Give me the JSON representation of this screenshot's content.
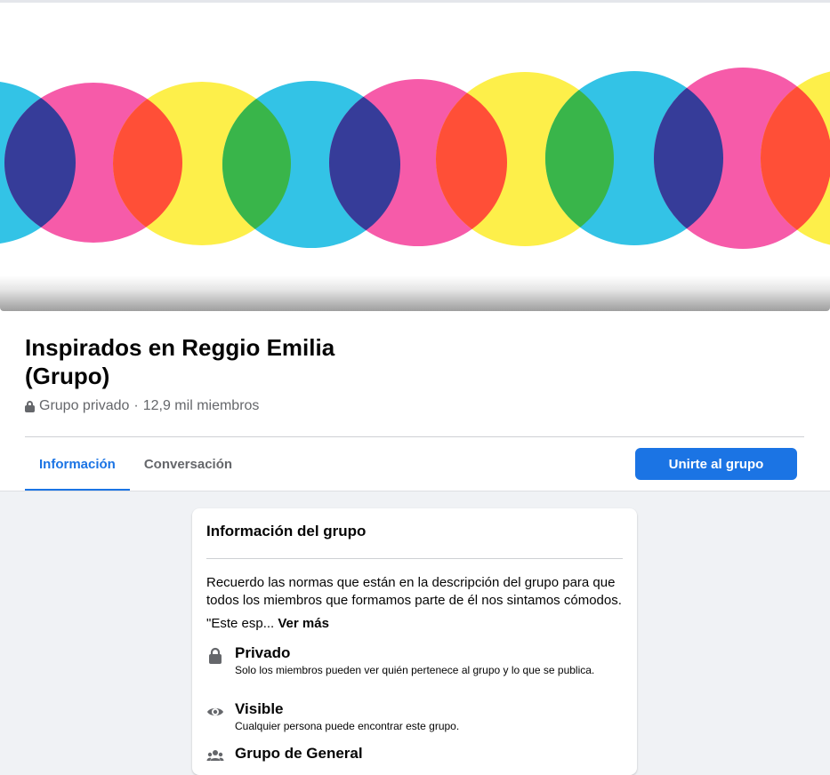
{
  "group": {
    "name": "Inspirados en Reggio Emilia (Grupo)",
    "privacy": "Grupo privado",
    "separator": "·",
    "members": "12,9 mil miembros"
  },
  "tabs": [
    {
      "label": "Información",
      "active": true
    },
    {
      "label": "Conversación",
      "active": false
    }
  ],
  "join_button": "Unirte al grupo",
  "about": {
    "title": "Información del grupo",
    "description": "Recuerdo las normas que están en la descripción del grupo para que todos los miembros que formamos parte de él nos sintamos cómodos.",
    "excerpt": "\"Este esp...",
    "see_more": "Ver más",
    "items": [
      {
        "icon": "lock-icon",
        "label": "Privado",
        "sub": "Solo los miembros pueden ver quién pertenece al grupo y lo que se publica."
      },
      {
        "icon": "eye-icon",
        "label": "Visible",
        "sub": "Cualquier persona puede encontrar este grupo."
      },
      {
        "icon": "people-icon",
        "label": "Grupo de General",
        "sub": ""
      }
    ]
  },
  "colors": {
    "accent": "#1b74e4",
    "cyan": "#33c3e6",
    "pink": "#f65ba9",
    "yellow": "#fdef4a",
    "navy": "#363c99",
    "orange": "#ff4f37",
    "green": "#39b54a"
  }
}
